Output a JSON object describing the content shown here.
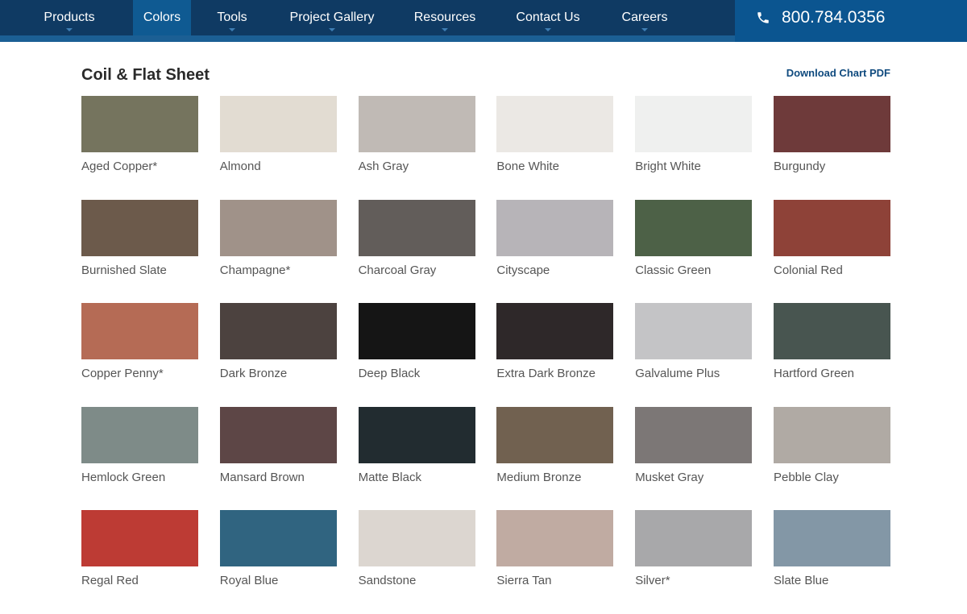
{
  "nav": {
    "items": [
      {
        "label": "Products",
        "caret": true
      },
      {
        "label": "Colors",
        "caret": false,
        "active": true
      },
      {
        "label": "Tools",
        "caret": true
      },
      {
        "label": "Project Gallery",
        "caret": true
      },
      {
        "label": "Resources",
        "caret": true
      },
      {
        "label": "Contact Us",
        "caret": true
      },
      {
        "label": "Careers",
        "caret": true
      }
    ],
    "phone": "800.784.0356",
    "phone_icon": "phone-icon"
  },
  "section": {
    "title": "Coil & Flat Sheet",
    "download_label": "Download Chart PDF"
  },
  "swatches": [
    {
      "name": "Aged Copper*",
      "color": "#75745e"
    },
    {
      "name": "Almond",
      "color": "#e2dcd2"
    },
    {
      "name": "Ash Gray",
      "color": "#c0bab5"
    },
    {
      "name": "Bone White",
      "color": "#ebe8e4"
    },
    {
      "name": "Bright White",
      "color": "#eff0ef"
    },
    {
      "name": "Burgundy",
      "color": "#6e3a3a"
    },
    {
      "name": "Burnished Slate",
      "color": "#6c5a4b"
    },
    {
      "name": "Champagne*",
      "color": "#a09289"
    },
    {
      "name": "Charcoal Gray",
      "color": "#625d5a"
    },
    {
      "name": "Cityscape",
      "color": "#b7b4b8"
    },
    {
      "name": "Classic Green",
      "color": "#4d6147"
    },
    {
      "name": "Colonial Red",
      "color": "#8e4238"
    },
    {
      "name": "Copper Penny*",
      "color": "#b56b55"
    },
    {
      "name": "Dark Bronze",
      "color": "#4c423f"
    },
    {
      "name": "Deep Black",
      "color": "#151515"
    },
    {
      "name": "Extra Dark Bronze",
      "color": "#2e2829"
    },
    {
      "name": "Galvalume Plus",
      "color": "#c4c4c6"
    },
    {
      "name": "Hartford Green",
      "color": "#485550"
    },
    {
      "name": "Hemlock Green",
      "color": "#7e8b88"
    },
    {
      "name": "Mansard Brown",
      "color": "#5d4646"
    },
    {
      "name": "Matte Black",
      "color": "#222c30"
    },
    {
      "name": "Medium Bronze",
      "color": "#716150"
    },
    {
      "name": "Musket Gray",
      "color": "#7c7776"
    },
    {
      "name": "Pebble Clay",
      "color": "#b0aaa4"
    },
    {
      "name": "Regal Red",
      "color": "#bd3b34"
    },
    {
      "name": "Royal Blue",
      "color": "#306480"
    },
    {
      "name": "Sandstone",
      "color": "#dcd6d0"
    },
    {
      "name": "Sierra Tan",
      "color": "#c0aba2"
    },
    {
      "name": "Silver*",
      "color": "#a8a8aa"
    },
    {
      "name": "Slate Blue",
      "color": "#8397a6"
    }
  ]
}
